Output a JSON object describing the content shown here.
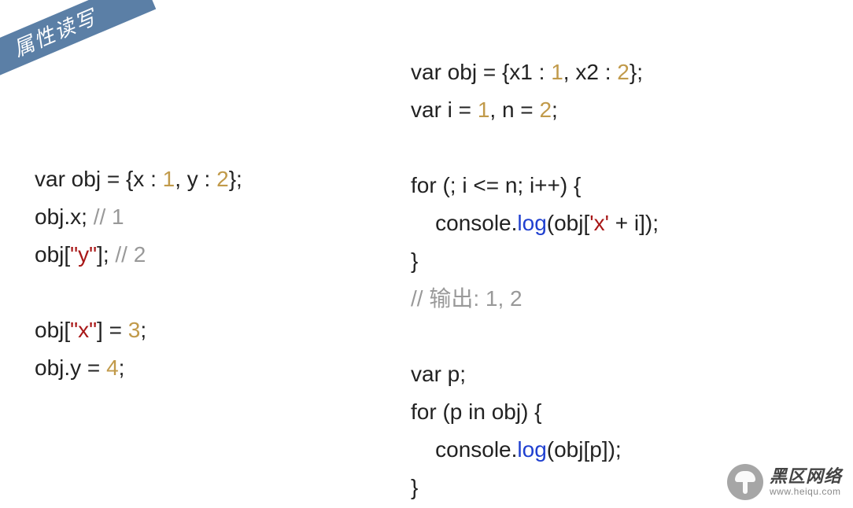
{
  "ribbon": "属性读写",
  "left": {
    "l1": {
      "a": "var obj = {x : ",
      "n1": "1",
      "b": ", y : ",
      "n2": "2",
      "c": "};"
    },
    "l2": {
      "a": "obj.x; ",
      "c": "// 1"
    },
    "l3": {
      "a": "obj[",
      "s": "\"y\"",
      "b": "]; ",
      "c": "// 2"
    },
    "l4": {
      "a": "obj[",
      "s": "\"x\"",
      "b": "] = ",
      "n": "3",
      "c": ";"
    },
    "l5": {
      "a": "obj.y = ",
      "n": "4",
      "b": ";"
    }
  },
  "right": {
    "r1": {
      "a": "var obj = {x1 : ",
      "n1": "1",
      "b": ", x2 : ",
      "n2": "2",
      "c": "};"
    },
    "r2": {
      "a": "var i = ",
      "n1": "1",
      "b": ", n = ",
      "n2": "2",
      "c": ";"
    },
    "r3": {
      "a": "for (; i <= n; i++) {"
    },
    "r4": {
      "a": "    console.",
      "f": "log",
      "b": "(obj[",
      "s": "'x'",
      "c": " + i]);"
    },
    "r5": {
      "a": "}"
    },
    "r6": {
      "c": "// 输出: 1, 2"
    },
    "r7": {
      "a": "var p;"
    },
    "r8": {
      "a": "for (p in obj) {"
    },
    "r9": {
      "a": "    console.",
      "f": "log",
      "b": "(obj[p]);"
    },
    "r10": {
      "a": "}"
    }
  },
  "watermark": {
    "title": "黑区网络",
    "url": "www.heiqu.com"
  }
}
